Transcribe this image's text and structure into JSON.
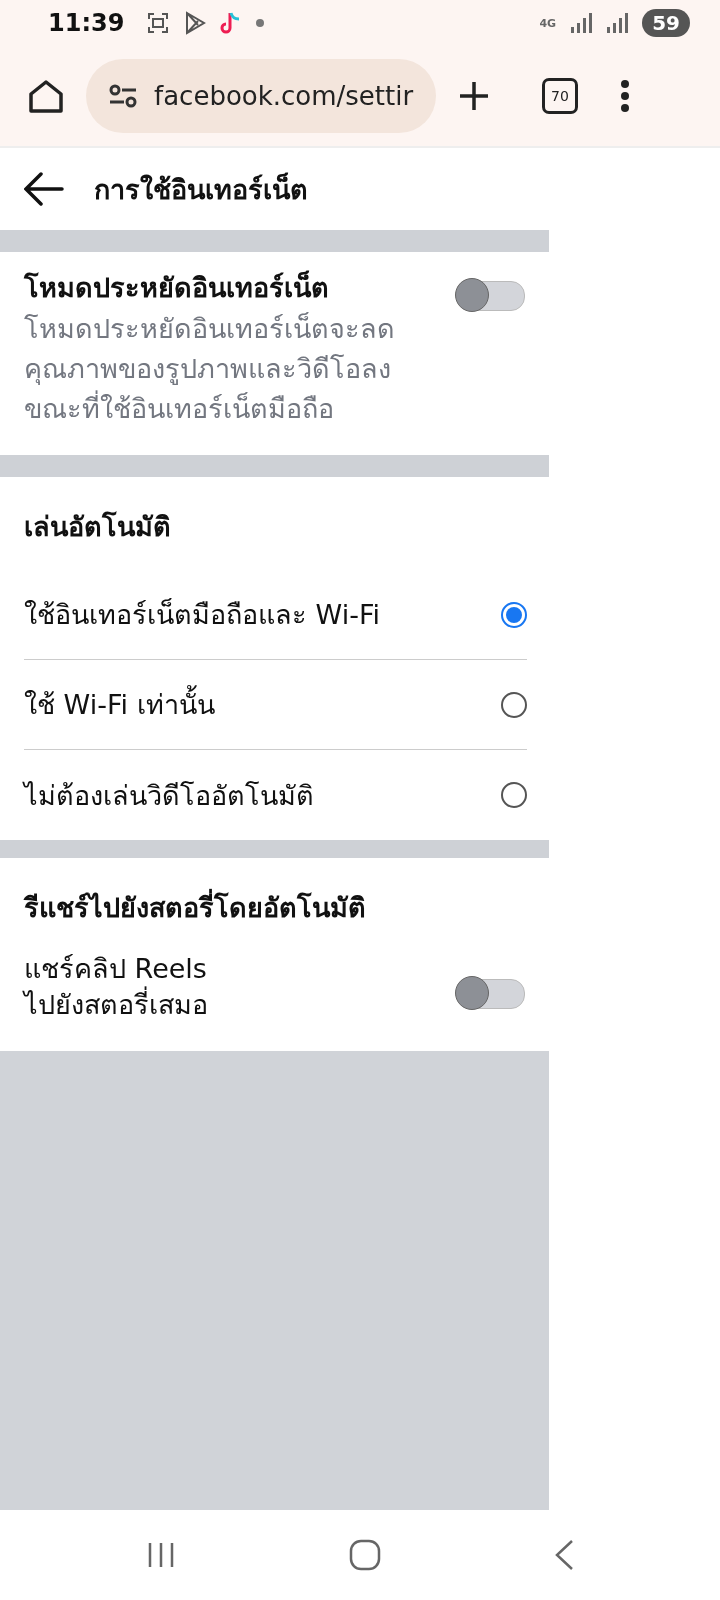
{
  "status_bar": {
    "time": "11:39",
    "network": "4G",
    "battery": "59"
  },
  "browser": {
    "url": "facebook.com/settir",
    "tab_count": "70"
  },
  "header": {
    "title": "การใช้อินเทอร์เน็ต"
  },
  "data_saver": {
    "title": "โหมดประหยัดอินเทอร์เน็ต",
    "description": "โหมดประหยัดอินเทอร์เน็ตจะลดคุณภาพของรูปภาพและวิดีโอลงขณะที่ใช้อินเทอร์เน็ตมือถือ",
    "on": false
  },
  "autoplay": {
    "heading": "เล่นอัตโนมัติ",
    "options": [
      {
        "label": "ใช้อินเทอร์เน็ตมือถือและ Wi-Fi",
        "selected": true
      },
      {
        "label": "ใช้ Wi-Fi เท่านั้น",
        "selected": false
      },
      {
        "label": "ไม่ต้องเล่นวิดีโออัตโนมัติ",
        "selected": false
      }
    ]
  },
  "reshare": {
    "heading": "รีแชร์ไปยังสตอรี่โดยอัตโนมัติ",
    "label": "แชร์คลิป Reels\nไปยังสตอรี่เสมอ",
    "on": false
  }
}
